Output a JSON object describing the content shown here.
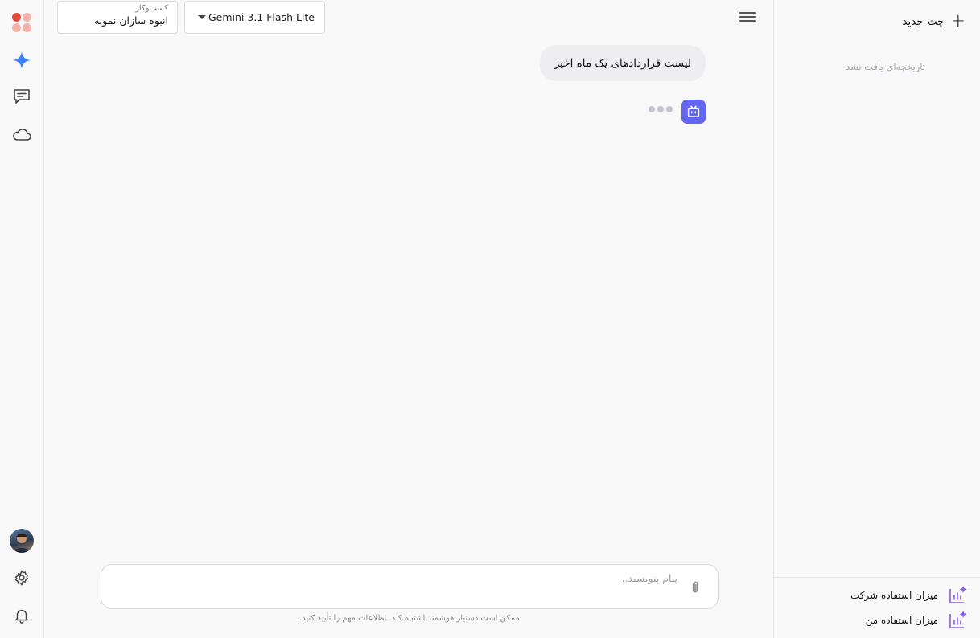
{
  "colors": {
    "accent": "#6366f1",
    "star": "#3b82f6",
    "usage_icon": "#8b5cf6",
    "logo_dark": "#e24a3b",
    "logo_light": "#f4b2ad"
  },
  "rail": {
    "icons": [
      "app-logo",
      "sparkle-icon",
      "chat-icon",
      "cloud-icon",
      "avatar",
      "gear-icon",
      "bell-icon"
    ]
  },
  "header": {
    "business_caption": "کسب‌وکار",
    "business_value": "انبوه سازان نمونه",
    "model_value": "Gemini 3.1 Flash Lite"
  },
  "conversation": {
    "user_message": "لیست قراردادهای یک ماه اخیر",
    "bot_status": "typing"
  },
  "composer": {
    "placeholder": "پیام بنویسید...",
    "disclaimer": "ممکن است دستیار هوشمند اشتباه کند. اطلاعات مهم را تأیید کنید."
  },
  "sidebar": {
    "new_chat_label": "چت جدید",
    "empty_history": "تاریخچه‌ای یافت نشد",
    "usage_company_label": "میزان استفاده شرکت",
    "usage_mine_label": "میزان استفاده من"
  }
}
